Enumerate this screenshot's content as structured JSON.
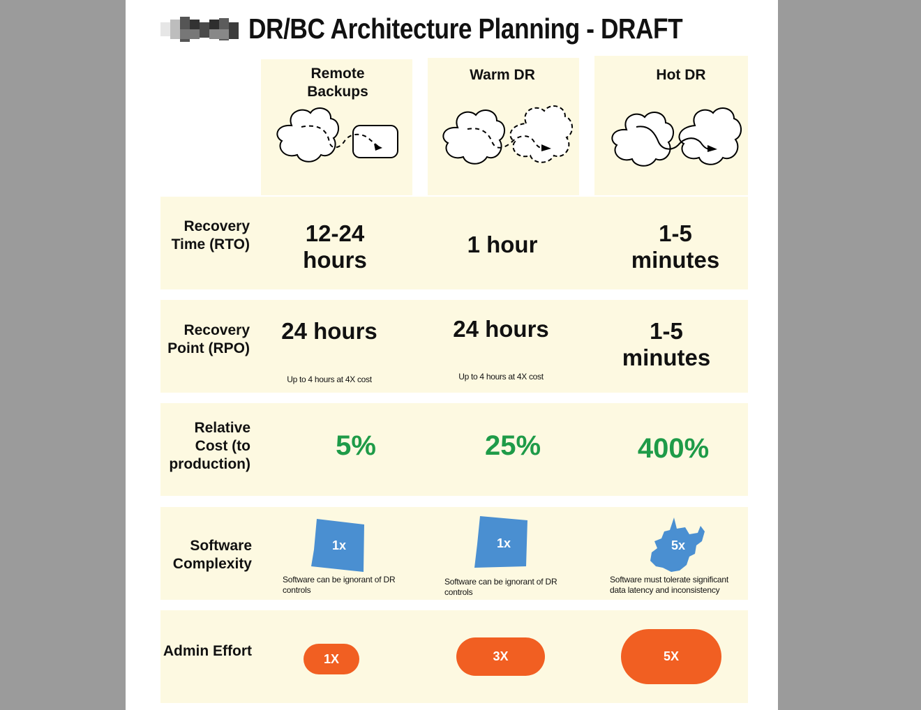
{
  "title": "DR/BC Architecture Planning - DRAFT",
  "columns": [
    {
      "name": "Remote Backups"
    },
    {
      "name": "Warm DR"
    },
    {
      "name": "Hot DR"
    }
  ],
  "rows": {
    "rto": {
      "label": "Recovery Time (RTO)",
      "values": [
        "12-24 hours",
        "1 hour",
        "1-5 minutes"
      ]
    },
    "rpo": {
      "label": "Recovery Point (RPO)",
      "values": [
        "24 hours",
        "24 hours",
        "1-5 minutes"
      ],
      "notes": [
        "Up to 4 hours at 4X cost",
        "Up to 4 hours at 4X cost",
        ""
      ]
    },
    "cost": {
      "label": "Relative Cost (to production)",
      "values": [
        "5%",
        "25%",
        "400%"
      ],
      "color": "#1e9b48"
    },
    "complexity": {
      "label": "Software Complexity",
      "multipliers": [
        "1x",
        "1x",
        "5x"
      ],
      "notes": [
        "Software can be ignorant of DR controls",
        "Software can be ignorant of DR controls",
        "Software must tolerate significant data latency and inconsistency"
      ],
      "color": "#4a8fd1"
    },
    "admin": {
      "label": "Admin Effort",
      "values": [
        "1X",
        "3X",
        "5X"
      ],
      "color": "#f15f22"
    }
  },
  "colors": {
    "cell_bg": "#fdf9e1",
    "page_bg": "#ffffff",
    "outer_bg": "#9b9b9b"
  }
}
